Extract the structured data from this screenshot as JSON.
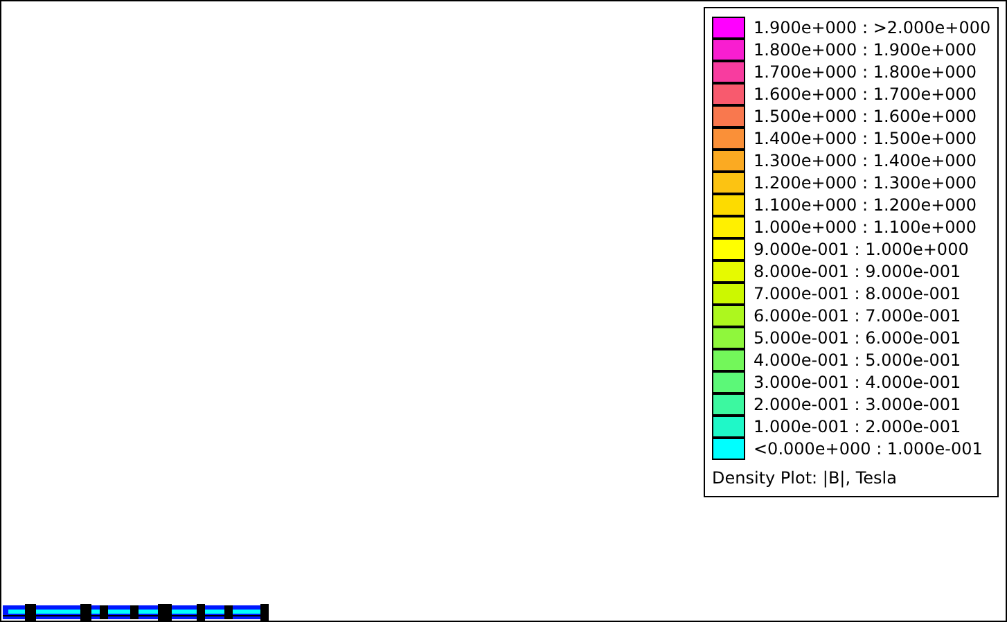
{
  "legend": {
    "entries": [
      {
        "label": "1.900e+000 : >2.000e+000",
        "color": "#ff00ff"
      },
      {
        "label": "1.800e+000 : 1.900e+000",
        "color": "#f81ed0"
      },
      {
        "label": "1.700e+000 : 1.800e+000",
        "color": "#f83c9f"
      },
      {
        "label": "1.600e+000 : 1.700e+000",
        "color": "#f85a6e"
      },
      {
        "label": "1.500e+000 : 1.600e+000",
        "color": "#f9784e"
      },
      {
        "label": "1.400e+000 : 1.500e+000",
        "color": "#fa9038"
      },
      {
        "label": "1.300e+000 : 1.400e+000",
        "color": "#fbaa22"
      },
      {
        "label": "1.200e+000 : 1.300e+000",
        "color": "#fcc312"
      },
      {
        "label": "1.100e+000 : 1.200e+000",
        "color": "#fddb00"
      },
      {
        "label": "1.000e+000 : 1.100e+000",
        "color": "#fff000"
      },
      {
        "label": "9.000e-001 : 1.000e+000",
        "color": "#ffff00"
      },
      {
        "label": "8.000e-001 : 9.000e-001",
        "color": "#e6fa00"
      },
      {
        "label": "7.000e-001 : 8.000e-001",
        "color": "#ccf800"
      },
      {
        "label": "6.000e-001 : 7.000e-001",
        "color": "#adf71e"
      },
      {
        "label": "5.000e-001 : 6.000e-001",
        "color": "#8ff73c"
      },
      {
        "label": "4.000e-001 : 5.000e-001",
        "color": "#73f75a"
      },
      {
        "label": "3.000e-001 : 4.000e-001",
        "color": "#5cf878"
      },
      {
        "label": "2.000e-001 : 3.000e-001",
        "color": "#3cf8a0"
      },
      {
        "label": "1.000e-001 : 2.000e-001",
        "color": "#1ff8c8"
      },
      {
        "label": "<0.000e+000 : 1.000e-001",
        "color": "#00ffff"
      }
    ],
    "caption": "Density Plot: |B|, Tesla"
  }
}
